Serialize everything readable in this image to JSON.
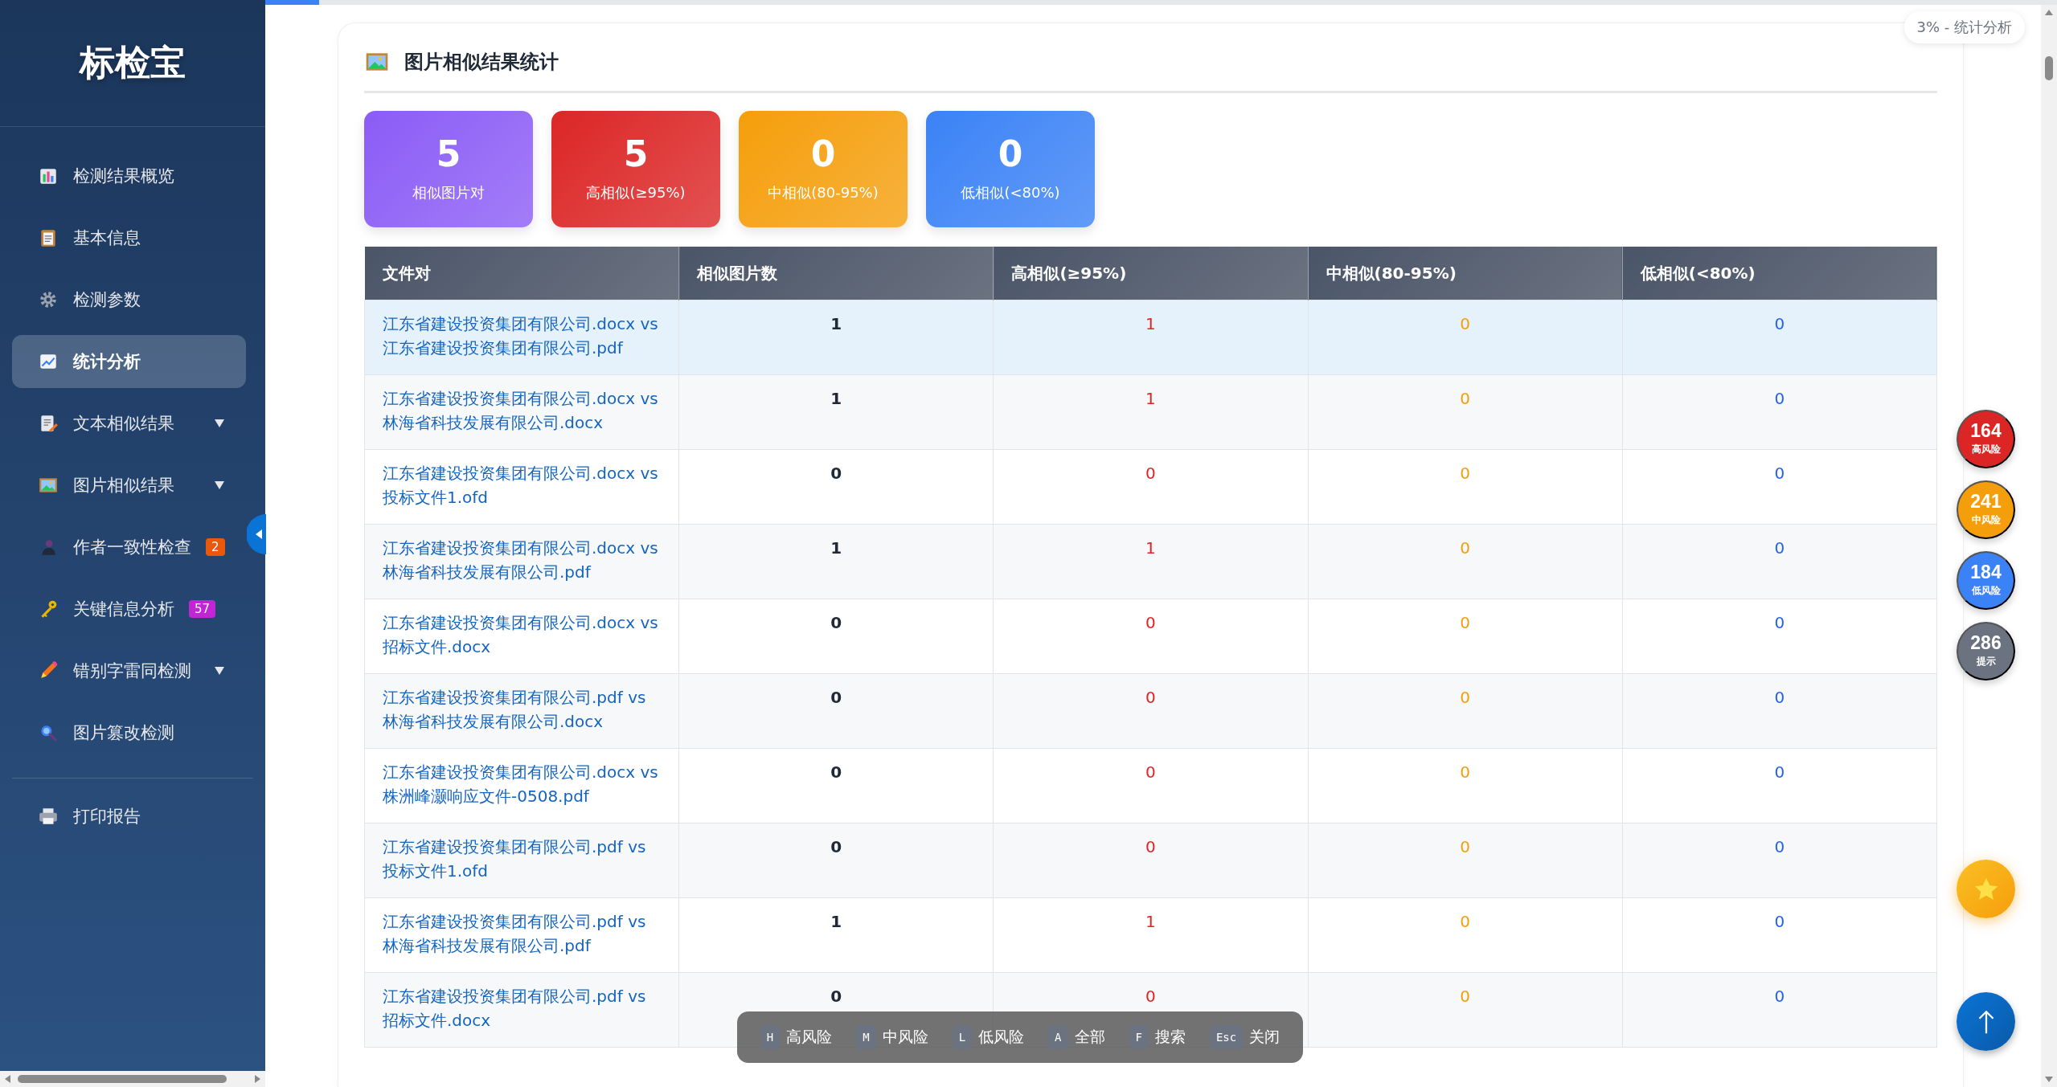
{
  "sidebar": {
    "logo": "标检宝",
    "items": [
      {
        "label": "检测结果概览",
        "selected": false,
        "has_submenu": false
      },
      {
        "label": "基本信息",
        "selected": false,
        "has_submenu": false
      },
      {
        "label": "检测参数",
        "selected": false,
        "has_submenu": false
      },
      {
        "label": "统计分析",
        "selected": true,
        "has_submenu": false
      },
      {
        "label": "文本相似结果",
        "selected": false,
        "has_submenu": true
      },
      {
        "label": "图片相似结果",
        "selected": false,
        "has_submenu": true
      },
      {
        "label": "作者一致性检查",
        "selected": false,
        "has_submenu": false,
        "badge": {
          "text": "2",
          "color": "#ea580c"
        }
      },
      {
        "label": "关键信息分析",
        "selected": false,
        "has_submenu": false,
        "badge": {
          "text": "57",
          "color": "#c026d3"
        }
      },
      {
        "label": "错别字雷同检测",
        "selected": false,
        "has_submenu": true
      },
      {
        "label": "图片篡改检测",
        "selected": false,
        "has_submenu": false
      }
    ],
    "footer_items": [
      {
        "label": "打印报告",
        "selected": false
      }
    ]
  },
  "progress": {
    "level": 0.03,
    "label": "3% - 统计分析"
  },
  "section": {
    "title": "图片相似结果统计",
    "stats": [
      {
        "value": "5",
        "label": "相似图片对",
        "color": "#8b5cf6"
      },
      {
        "value": "5",
        "label": "高相似(≥95%)",
        "color": "#dc2626"
      },
      {
        "value": "0",
        "label": "中相似(80-95%)",
        "color": "#f59e0b"
      },
      {
        "value": "0",
        "label": "低相似(<80%)",
        "color": "#3b82f6"
      }
    ],
    "table": {
      "columns": [
        "文件对",
        "相似图片数",
        "高相似(≥95%)",
        "中相似(80-95%)",
        "低相似(<80%)"
      ],
      "rows": [
        {
          "pair": "江东省建设投资集团有限公司.docx vs 江东省建设投资集团有限公司.pdf",
          "count": "1",
          "high": "1",
          "mid": "0",
          "low": "0",
          "selected": true
        },
        {
          "pair": "江东省建设投资集团有限公司.docx vs 林海省科技发展有限公司.docx",
          "count": "1",
          "high": "1",
          "mid": "0",
          "low": "0",
          "selected": false
        },
        {
          "pair": "江东省建设投资集团有限公司.docx vs 投标文件1.ofd",
          "count": "0",
          "high": "0",
          "mid": "0",
          "low": "0",
          "selected": false
        },
        {
          "pair": "江东省建设投资集团有限公司.docx vs 林海省科技发展有限公司.pdf",
          "count": "1",
          "high": "1",
          "mid": "0",
          "low": "0",
          "selected": false
        },
        {
          "pair": "江东省建设投资集团有限公司.docx vs 招标文件.docx",
          "count": "0",
          "high": "0",
          "mid": "0",
          "low": "0",
          "selected": false
        },
        {
          "pair": "江东省建设投资集团有限公司.pdf vs 林海省科技发展有限公司.docx",
          "count": "0",
          "high": "0",
          "mid": "0",
          "low": "0",
          "selected": false
        },
        {
          "pair": "江东省建设投资集团有限公司.docx vs 株洲峰灏响应文件-0508.pdf",
          "count": "0",
          "high": "0",
          "mid": "0",
          "low": "0",
          "selected": false
        },
        {
          "pair": "江东省建设投资集团有限公司.pdf vs 投标文件1.ofd",
          "count": "0",
          "high": "0",
          "mid": "0",
          "low": "0",
          "selected": false
        },
        {
          "pair": "江东省建设投资集团有限公司.pdf vs 林海省科技发展有限公司.pdf",
          "count": "1",
          "high": "1",
          "mid": "0",
          "low": "0",
          "selected": false
        },
        {
          "pair": "江东省建设投资集团有限公司.pdf vs 招标文件.docx",
          "count": "0",
          "high": "0",
          "mid": "0",
          "low": "0",
          "selected": false
        }
      ]
    }
  },
  "risk_counters": [
    {
      "count": "164",
      "label": "高风险",
      "color": "#dc2626"
    },
    {
      "count": "241",
      "label": "中风险",
      "color": "#f59e0b"
    },
    {
      "count": "184",
      "label": "低风险",
      "color": "#3b82f6"
    },
    {
      "count": "286",
      "label": "提示",
      "color": "#6b7280"
    }
  ],
  "shortcuts": [
    {
      "key": "H",
      "label": "高风险"
    },
    {
      "key": "M",
      "label": "中风险"
    },
    {
      "key": "L",
      "label": "低风险"
    },
    {
      "key": "A",
      "label": "全部"
    },
    {
      "key": "F",
      "label": "搜索"
    },
    {
      "key": "Esc",
      "label": "关闭"
    }
  ]
}
